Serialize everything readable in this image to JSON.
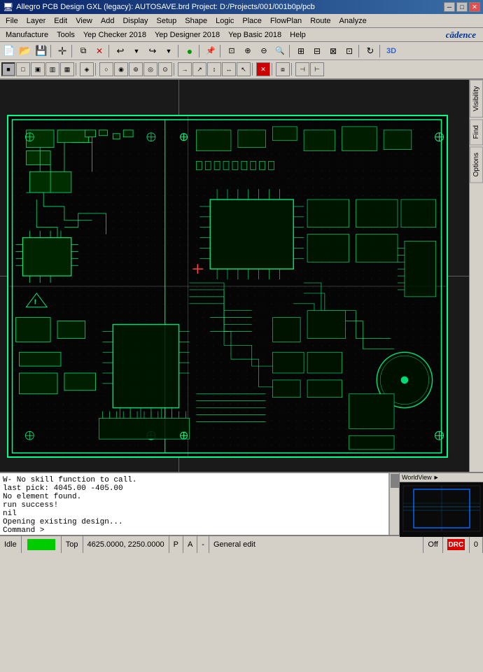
{
  "titlebar": {
    "title": "Allegro PCB Design GXL (legacy): AUTOSAVE.brd  Project: D:/Projects/001/001b0p/pcb",
    "icon": "🖥",
    "minimize": "─",
    "maximize": "□",
    "close": "✕"
  },
  "menu1": {
    "items": [
      "File",
      "Layer",
      "Edit",
      "View",
      "Add",
      "Display",
      "Setup",
      "Shape",
      "Logic",
      "Place",
      "FlowPlan",
      "Route",
      "Analyze"
    ]
  },
  "menu2": {
    "items": [
      "Manufacture",
      "Tools",
      "Yep Checker 2018",
      "Yep Designer 2018",
      "Yep Basic 2018",
      "Help"
    ],
    "logo": "cādence"
  },
  "console": {
    "lines": [
      "W- No skill function to call.",
      "last pick:  4045.00 -405.00",
      "No element found.",
      "run success!",
      "nil",
      "Opening existing design...",
      "Command >"
    ]
  },
  "statusbar": {
    "idle": "Idle",
    "layer": "Top",
    "coords": "4625.0000, 2250.0000",
    "p_label": "P",
    "a_label": "A",
    "dash": "-",
    "mode": "General edit",
    "off": "Off",
    "drc": "DRC",
    "num": "0"
  },
  "sidepanel": {
    "tabs": [
      "Visibility",
      "Find",
      "Options"
    ]
  },
  "worldview": {
    "label": "WorldView ►"
  },
  "toolbar1": {
    "buttons": [
      "new",
      "open",
      "save",
      "sep",
      "crosshair",
      "sep",
      "copy",
      "delete",
      "sep",
      "undo-arrow",
      "undo-down",
      "redo-arrow",
      "redo-down",
      "sep",
      "green-circle",
      "sep",
      "pin",
      "sep",
      "zoom-fit",
      "zoom-in",
      "zoom-out",
      "zoom-by",
      "sep",
      "zoom-pan",
      "sep",
      "x",
      "sep",
      "3d"
    ]
  },
  "toolbar2": {
    "buttons": [
      "sq1",
      "sq2",
      "sq3",
      "sq4",
      "sq5",
      "sep",
      "sq6",
      "sep",
      "sq7",
      "sq8",
      "sq9",
      "sq10",
      "sq11",
      "sep",
      "sq12",
      "sq13",
      "sq14",
      "sq15",
      "sq16",
      "sep",
      "stop",
      "sep",
      "sq17",
      "sep",
      "sq18",
      "sq19"
    ]
  }
}
